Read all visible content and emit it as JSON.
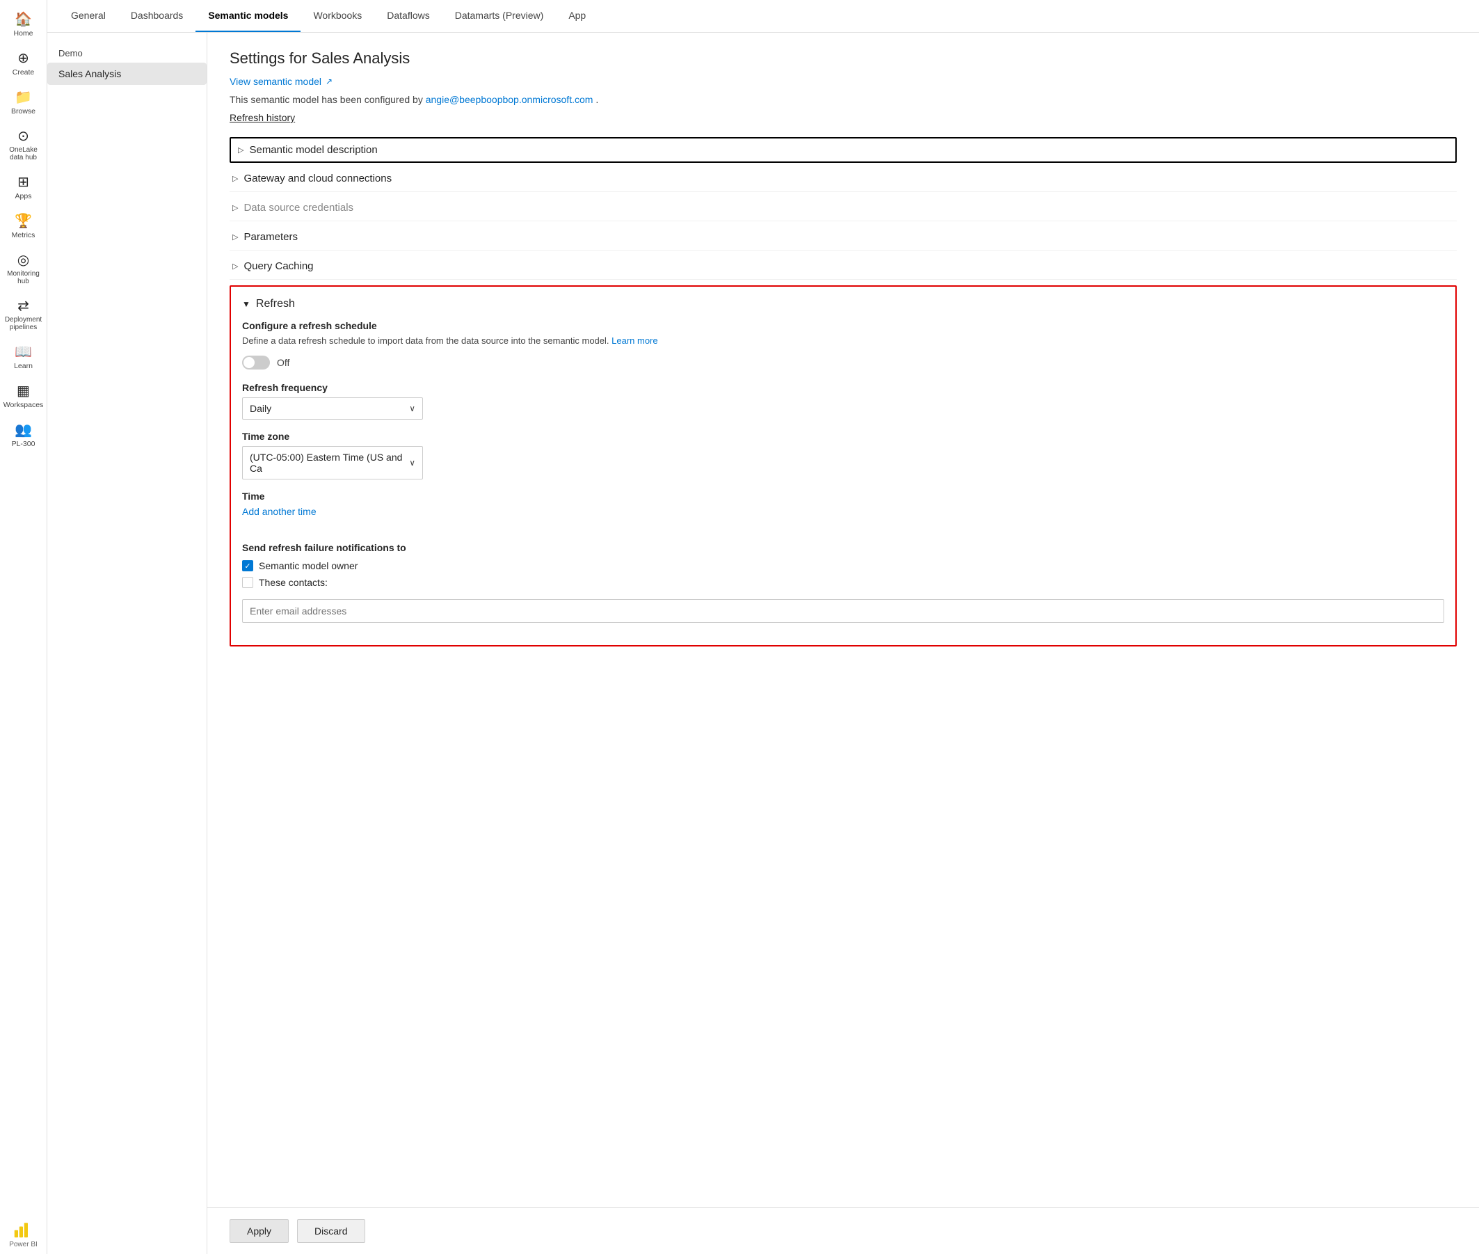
{
  "sidebar": {
    "items": [
      {
        "id": "home",
        "label": "Home",
        "icon": "🏠"
      },
      {
        "id": "create",
        "label": "Create",
        "icon": "⊕"
      },
      {
        "id": "browse",
        "label": "Browse",
        "icon": "📁"
      },
      {
        "id": "onelake",
        "label": "OneLake data hub",
        "icon": "⊙"
      },
      {
        "id": "apps",
        "label": "Apps",
        "icon": "⊞"
      },
      {
        "id": "metrics",
        "label": "Metrics",
        "icon": "🏆"
      },
      {
        "id": "monitoring",
        "label": "Monitoring hub",
        "icon": "◎"
      },
      {
        "id": "deployment",
        "label": "Deployment pipelines",
        "icon": "⇄"
      },
      {
        "id": "learn",
        "label": "Learn",
        "icon": "📖"
      },
      {
        "id": "workspaces",
        "label": "Workspaces",
        "icon": "▦"
      },
      {
        "id": "pl300",
        "label": "PL-300",
        "icon": "👥"
      }
    ]
  },
  "tabs": {
    "items": [
      {
        "id": "general",
        "label": "General",
        "active": false
      },
      {
        "id": "dashboards",
        "label": "Dashboards",
        "active": false
      },
      {
        "id": "semantic-models",
        "label": "Semantic models",
        "active": true
      },
      {
        "id": "workbooks",
        "label": "Workbooks",
        "active": false
      },
      {
        "id": "dataflows",
        "label": "Dataflows",
        "active": false
      },
      {
        "id": "datamarts",
        "label": "Datamarts (Preview)",
        "active": false
      },
      {
        "id": "app",
        "label": "App",
        "active": false
      }
    ]
  },
  "left_panel": {
    "workspace": "Demo",
    "items": [
      {
        "id": "sales-analysis",
        "label": "Sales Analysis",
        "selected": true
      }
    ]
  },
  "settings": {
    "title": "Settings for Sales Analysis",
    "view_link": "View semantic model",
    "config_text": "This semantic model has been configured by",
    "config_email": "angie@beepboopbop.onmicrosoft.com",
    "refresh_history": "Refresh history",
    "sections": [
      {
        "id": "description",
        "label": "Semantic model description",
        "expanded": false,
        "dimmed": false,
        "focused": true
      },
      {
        "id": "gateway",
        "label": "Gateway and cloud connections",
        "expanded": false,
        "dimmed": false
      },
      {
        "id": "datasource",
        "label": "Data source credentials",
        "expanded": false,
        "dimmed": true
      },
      {
        "id": "parameters",
        "label": "Parameters",
        "expanded": false,
        "dimmed": false
      },
      {
        "id": "query-caching",
        "label": "Query Caching",
        "expanded": false,
        "dimmed": false
      }
    ],
    "refresh_section": {
      "label": "Refresh",
      "configure_label": "Configure a refresh schedule",
      "description": "Define a data refresh schedule to import data from the data source into the semantic model.",
      "learn_more": "Learn more",
      "toggle_state": "Off",
      "frequency_label": "Refresh frequency",
      "frequency_value": "Daily",
      "timezone_label": "Time zone",
      "timezone_value": "(UTC-05:00) Eastern Time (US and Ca",
      "time_label": "Time",
      "add_time_label": "Add another time",
      "notifications_label": "Send refresh failure notifications to",
      "semantic_model_owner_label": "Semantic model owner",
      "semantic_model_owner_checked": true,
      "these_contacts_label": "These contacts:",
      "these_contacts_checked": false,
      "email_placeholder": "Enter email addresses"
    }
  },
  "bottom_bar": {
    "apply_label": "Apply",
    "discard_label": "Discard"
  }
}
